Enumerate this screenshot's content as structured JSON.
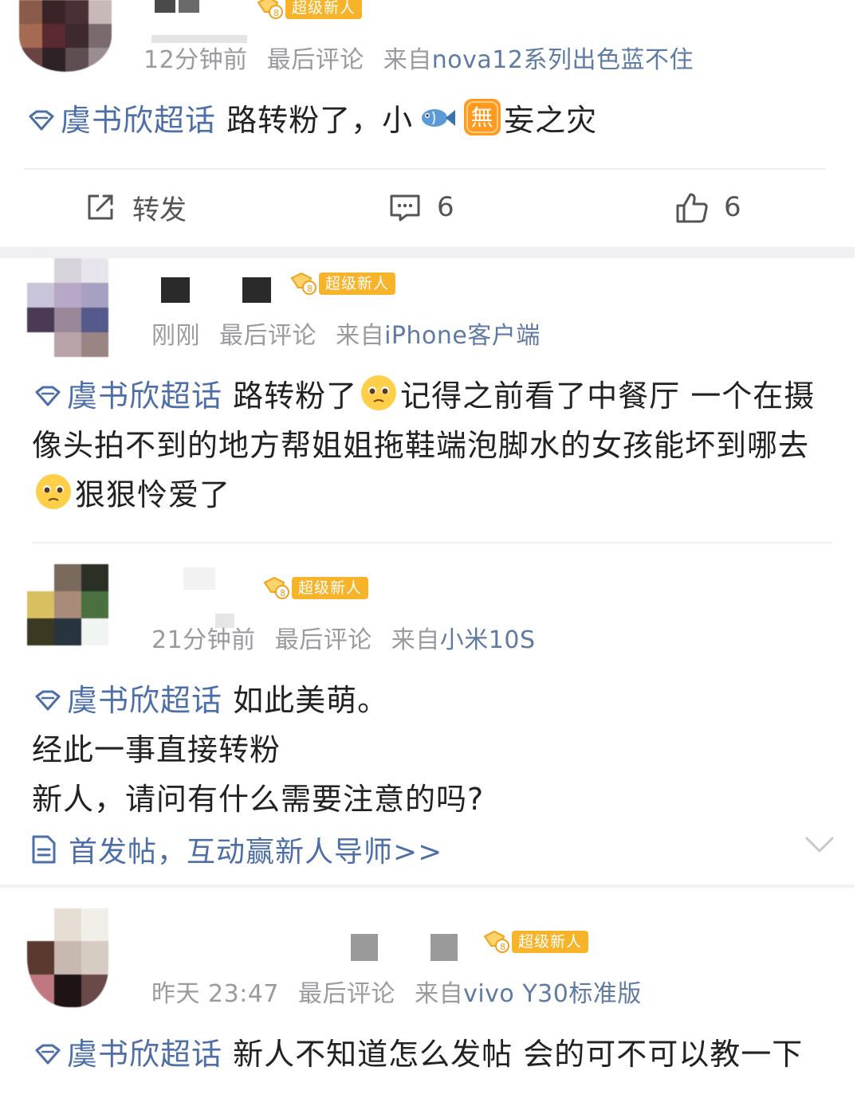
{
  "badge_label": "超级新人",
  "topic": "虞书欣超话",
  "posts": [
    {
      "time": "12分钟前",
      "last_comment": "最后评论",
      "source_prefix": "来自",
      "source": "nova12系列出色蓝不住",
      "text_a": "路转粉了，小",
      "text_b": "妄之灾",
      "icons": [
        "fish-emoji",
        "wu-character-sticker"
      ]
    },
    {
      "time": "刚刚",
      "last_comment": "最后评论",
      "source_prefix": "来自",
      "source": "iPhone客户端",
      "text_a": "路转粉了",
      "text_b": "记得之前看了中餐厅 一个在摄像头拍不到的地方帮姐姐拖鞋端泡脚水的女孩能坏到哪去",
      "text_c": "狠狠怜爱了",
      "icons": [
        "pleading-face-emoji"
      ]
    },
    {
      "time": "21分钟前",
      "last_comment": "最后评论",
      "source_prefix": "来自",
      "source": "小米10S",
      "line1": "如此美萌。",
      "line2": "经此一事直接转粉",
      "line3": "新人，请问有什么需要注意的吗?",
      "link": "首发帖，互动赢新人导师>>"
    },
    {
      "time": "昨天 23:47",
      "last_comment": "最后评论",
      "source_prefix": "来自",
      "source": "vivo Y30标准版",
      "text": "新人不知道怎么发帖 会的可不可以教一下"
    }
  ],
  "actions": {
    "repost_label": "转发",
    "comment_count": "6",
    "like_count": "6"
  },
  "colors": {
    "topic_link": "#4d6ea7",
    "badge": "#f7b42a",
    "meta_text": "#9a9aa0",
    "source_text": "#5f7aa3"
  }
}
